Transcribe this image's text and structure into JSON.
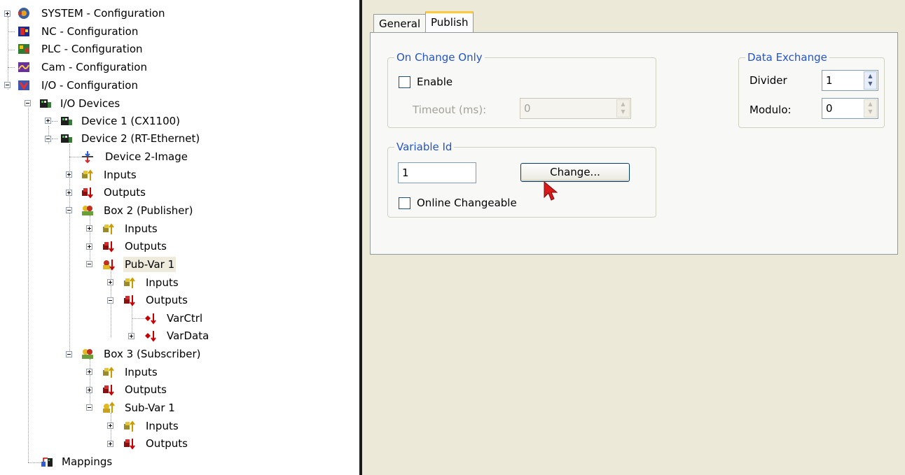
{
  "tree": {
    "items": [
      {
        "label": "SYSTEM - Configuration",
        "icon": "system-config-icon"
      },
      {
        "label": "NC - Configuration",
        "icon": "nc-config-icon"
      },
      {
        "label": "PLC - Configuration",
        "icon": "plc-config-icon"
      },
      {
        "label": "Cam - Configuration",
        "icon": "cam-config-icon"
      },
      {
        "label": "I/O - Configuration",
        "icon": "io-config-icon"
      },
      {
        "label": "I/O Devices",
        "icon": "io-devices-icon"
      },
      {
        "label": "Device 1 (CX1100)",
        "icon": "device-icon"
      },
      {
        "label": "Device 2 (RT-Ethernet)",
        "icon": "device-icon"
      },
      {
        "label": "Device 2-Image",
        "icon": "device-image-icon"
      },
      {
        "label": "Inputs",
        "icon": "inputs-icon"
      },
      {
        "label": "Outputs",
        "icon": "outputs-icon"
      },
      {
        "label": "Box 2 (Publisher)",
        "icon": "box-icon"
      },
      {
        "label": "Inputs",
        "icon": "inputs-icon"
      },
      {
        "label": "Outputs",
        "icon": "outputs-icon"
      },
      {
        "label": "Pub-Var 1",
        "icon": "pub-var-icon"
      },
      {
        "label": "Inputs",
        "icon": "inputs-icon"
      },
      {
        "label": "Outputs",
        "icon": "outputs-icon"
      },
      {
        "label": "VarCtrl",
        "icon": "var-output-icon"
      },
      {
        "label": "VarData",
        "icon": "var-output-icon"
      },
      {
        "label": "Box 3 (Subscriber)",
        "icon": "box-icon"
      },
      {
        "label": "Inputs",
        "icon": "inputs-icon"
      },
      {
        "label": "Outputs",
        "icon": "outputs-icon"
      },
      {
        "label": "Sub-Var 1",
        "icon": "sub-var-icon"
      },
      {
        "label": "Inputs",
        "icon": "inputs-icon"
      },
      {
        "label": "Outputs",
        "icon": "outputs-icon"
      },
      {
        "label": "Mappings",
        "icon": "mappings-icon"
      }
    ]
  },
  "tabs": [
    {
      "label": "General"
    },
    {
      "label": "Publish"
    }
  ],
  "on_change": {
    "title": "On Change Only",
    "enable_label": "Enable",
    "timeout_label": "Timeout (ms):",
    "timeout_value": "0"
  },
  "data_exchange": {
    "title": "Data Exchange",
    "divider_label": "Divider",
    "divider_value": "1",
    "modulo_label": "Modulo:",
    "modulo_value": "0"
  },
  "variable_id": {
    "title": "Variable Id",
    "value": "1",
    "change_label": "Change...",
    "online_label": "Online Changeable"
  },
  "colors": {
    "group_title": "#2454c8",
    "panel_bg": "#ece9d8",
    "tab_highlight": "#ffc83c"
  }
}
